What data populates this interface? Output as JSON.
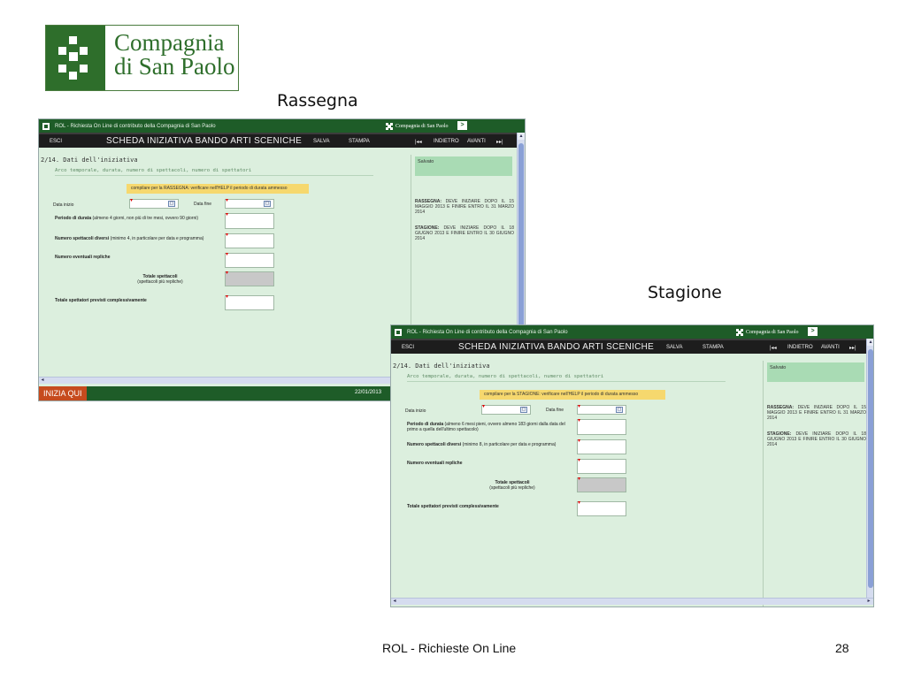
{
  "logo": {
    "line1": "Compagnia",
    "line2": "di San Paolo"
  },
  "labels": {
    "rassegna": "Rassegna",
    "stagione": "Stagione"
  },
  "footer": {
    "text": "ROL - Richieste On Line",
    "page": "28"
  },
  "windows": [
    {
      "title": "ROL - Richiesta On Line di contributo della Compagnia di San Paolo",
      "brand": "Compagnia di San Paolo",
      "toolbar": {
        "esci": "ESCI",
        "title": "SCHEDA INIZIATIVA BANDO ARTI SCENICHE",
        "salva": "SALVA",
        "stampa": "STAMPA",
        "first": "|◂◂",
        "indietro": "INDIETRO",
        "avanti": "AVANTI",
        "last": "▸▸|"
      },
      "section": "2/14. Dati dell'iniziativa",
      "subsection": "Arco temporale, durata, numero di spettacoli, numero di spettatori",
      "note": "compilare per la RASSEGNA:  verificare nell'HELP il periodo di durata ammesso",
      "fields": {
        "data_inizio": "Data inizio",
        "data_fine": "Data fine",
        "periodo_bold": "Periodo di durata",
        "periodo_rest": " (almeno 4 giorni, non più di tre mesi, ovvero 90 giorni)",
        "numero_bold": "Numero spettacoli diversi",
        "numero_rest": " (minimo 4, in particolare per data e programma)",
        "repliche": "Numero eventuali repliche",
        "totale": "Totale spettacoli",
        "totale_sub": "(spettacoli più repliche)",
        "spettatori": "Totale spettatori previsti complessivamente"
      },
      "sidebar": {
        "saved": "Salvato",
        "rassegna_bold": "RASSEGNA:",
        "rassegna_text": " DEVE INIZIARE DOPO IL 15 MAGGIO 2013 E FINIRE ENTRO IL 31 MARZO 2014",
        "stagione_bold": "STAGIONE:",
        "stagione_text": " DEVE INIZIARE DOPO IL 18 GIUGNO 2013 E FINIRE ENTRO IL 30 GIUGNO 2014"
      },
      "bottom": {
        "inizia": "INIZIA QUI",
        "date": "22/01/2013"
      }
    },
    {
      "title": "ROL - Richiesta On Line di contributo della Compagnia di San Paolo",
      "brand": "Compagnia di San Paolo",
      "toolbar": {
        "esci": "ESCI",
        "title": "SCHEDA INIZIATIVA BANDO ARTI SCENICHE",
        "salva": "SALVA",
        "stampa": "STAMPA",
        "first": "|◂◂",
        "indietro": "INDIETRO",
        "avanti": "AVANTI",
        "last": "▸▸|"
      },
      "section": "2/14. Dati dell'iniziativa",
      "subsection": "Arco temporale, durata, numero di spettacoli, numero di spettatori",
      "note": "compilare per la STAGIONE:  verificare nell'HELP il periodo di durata ammesso",
      "fields": {
        "data_inizio": "Data inizio",
        "data_fine": "Data fine",
        "periodo_bold": "Periodo di durata",
        "periodo_rest": " (almeno 6 mesi pieni, ovvero almeno 183 giorni dalla data del primo a quella dell'ultimo spettacolo)",
        "numero_bold": "Numero spettacoli diversi",
        "numero_rest": " (minimo 8, in particolare per data e programma)",
        "repliche": "Numero eventuali repliche",
        "totale": "Totale spettacoli",
        "totale_sub": "(spettacoli più repliche)",
        "spettatori": "Totale spettatori previsti complessivamente"
      },
      "sidebar": {
        "saved": "Salvato",
        "rassegna_bold": "RASSEGNA:",
        "rassegna_text": " DEVE INIZIARE DOPO IL 15 MAGGIO 2013 E FINIRE ENTRO IL 31 MARZO 2014",
        "stagione_bold": "STAGIONE:",
        "stagione_text": " DEVE INIZIARE DOPO IL 18 GIUGNO 2013 E FINIRE ENTRO IL 30 GIUGNO 2014"
      }
    }
  ]
}
